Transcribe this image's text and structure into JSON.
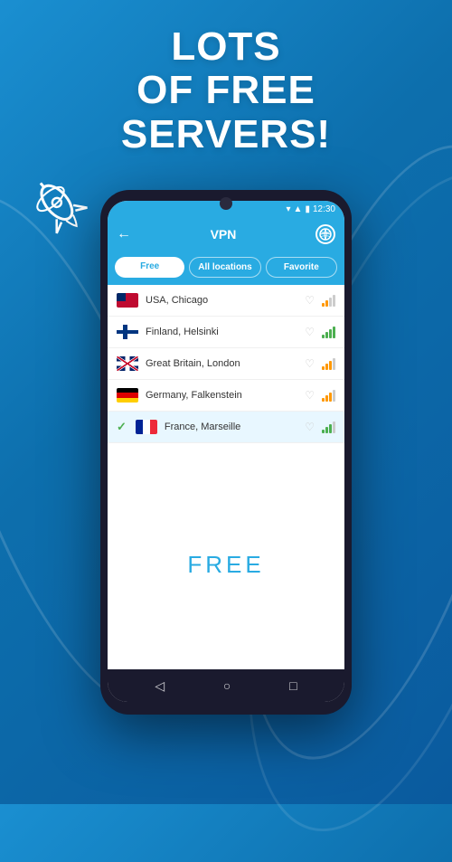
{
  "background": {
    "gradient_start": "#1a8fd1",
    "gradient_end": "#0a5a9e"
  },
  "header": {
    "title_line1": "Lots",
    "title_line2": "of free",
    "title_line3": "servers!"
  },
  "phone": {
    "status_bar": {
      "time": "12:30"
    },
    "app_bar": {
      "title": "VPN",
      "back_label": "←"
    },
    "tabs": [
      {
        "label": "Free",
        "active": true
      },
      {
        "label": "All locations",
        "active": false
      },
      {
        "label": "Favorite",
        "active": false
      }
    ],
    "servers": [
      {
        "country": "USA",
        "city": "Chicago",
        "flag_type": "usa",
        "selected": false,
        "signal": "medium"
      },
      {
        "country": "Finland",
        "city": "Helsinki",
        "flag_type": "finland",
        "selected": false,
        "signal": "high"
      },
      {
        "country": "Great Britain",
        "city": "London",
        "flag_type": "gb",
        "selected": false,
        "signal": "medium"
      },
      {
        "country": "Germany",
        "city": "Falkenstein",
        "flag_type": "germany",
        "selected": false,
        "signal": "medium"
      },
      {
        "country": "France",
        "city": "Marseille",
        "flag_type": "france",
        "selected": true,
        "signal": "high"
      }
    ],
    "free_label": "FREE",
    "nav": {
      "back": "◁",
      "home": "○",
      "recent": "□"
    }
  }
}
